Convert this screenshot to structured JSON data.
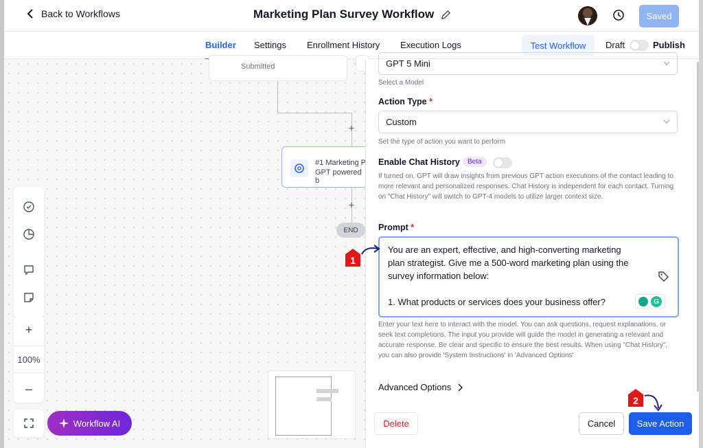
{
  "header": {
    "back_label": "Back to Workflows",
    "title": "Marketing Plan Survey Workflow",
    "saved_label": "Saved"
  },
  "tabs": [
    {
      "label": "Builder",
      "active": true
    },
    {
      "label": "Settings",
      "active": false
    },
    {
      "label": "Enrollment History",
      "active": false
    },
    {
      "label": "Execution Logs",
      "active": false
    }
  ],
  "tabbar": {
    "test_label": "Test Workflow",
    "draft_label": "Draft",
    "publish_label": "Publish"
  },
  "canvas": {
    "submitted_node": "Submitted",
    "action_node_title": "#1 Marketing P",
    "action_node_subtitle": "GPT powered b",
    "end_label": "END",
    "zoom_in": "+",
    "zoom_level": "100%",
    "zoom_out": "–",
    "workflow_ai_label": "Workflow AI"
  },
  "panel": {
    "model_value": "GPT 5 Mini",
    "model_hint": "Select a Model",
    "action_type_label": "Action Type",
    "action_type_value": "Custom",
    "action_type_hint": "Set the type of action you want to perform",
    "chat_history_label": "Enable Chat History",
    "beta_label": "Beta",
    "chat_history_hint": "If turned on, GPT will draw insights from previous GPT action executions of the contact leading to more relevant and personalized responses. Chat History is independent for each contact. Turning on \"Chat History\" will switch to GPT-4 models to utilize larger context size.",
    "prompt_label": "Prompt",
    "prompt_line1": "You are an expert, effective, and high-converting marketing",
    "prompt_line2": "plan strategist. Give me a 500-word marketing plan using the",
    "prompt_line3": "survey information below:",
    "prompt_line4": "1. What products or services does your business offer?",
    "prompt_hint": "Enter your text here to interact with the model. You can ask questions, request explanations, or seek text completions. The input you provide will guide the model in generating a relevant and accurate response. Be clear and specific to ensure the best results. When using \"Chat History\", you can also provide 'System Instructions' in 'Advanced Options'",
    "advanced_label": "Advanced Options",
    "delete_label": "Delete",
    "cancel_label": "Cancel",
    "save_label": "Save Action"
  },
  "annotations": {
    "marker1": "1",
    "marker2": "2",
    "color": "#e01818"
  },
  "colors": {
    "primary": "#1d5ee8",
    "accent_purple": "#6d28d9",
    "danger": "#dc2626"
  }
}
